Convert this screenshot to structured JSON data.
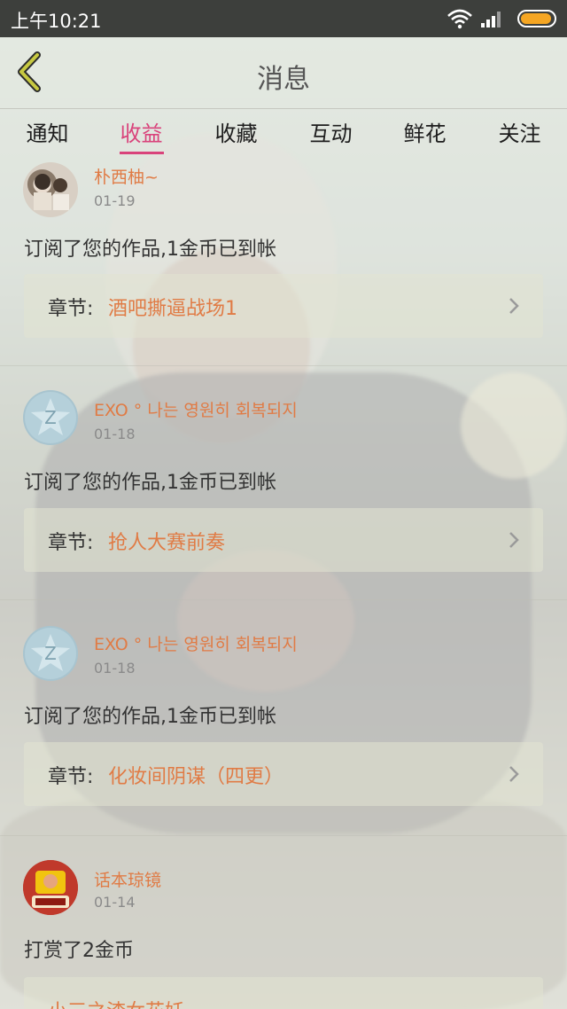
{
  "status_bar": {
    "time": "上午10:21"
  },
  "header": {
    "title": "消息"
  },
  "tabs": [
    {
      "label": "通知"
    },
    {
      "label": "收益"
    },
    {
      "label": "收藏"
    },
    {
      "label": "互动"
    },
    {
      "label": "鲜花"
    },
    {
      "label": "关注"
    }
  ],
  "messages": [
    {
      "username": "朴西柚~",
      "date": "01-19",
      "text": "订阅了您的作品,1金币已到帐",
      "chapter_prefix": "章节:",
      "chapter_title": "酒吧撕逼战场1"
    },
    {
      "username": "EXO ° 나는 영원히 회복되지",
      "date": "01-18",
      "text": "订阅了您的作品,1金币已到帐",
      "chapter_prefix": "章节:",
      "chapter_title": "抢人大赛前奏"
    },
    {
      "username": "EXO ° 나는 영원히 회복되지",
      "date": "01-18",
      "text": "订阅了您的作品,1金币已到帐",
      "chapter_prefix": "章节:",
      "chapter_title": "化妆间阴谋（四更）"
    },
    {
      "username": "话本琼镜",
      "date": "01-14",
      "text": "打赏了2金币",
      "chapter_title": "小三之渣女花妖"
    }
  ],
  "colors": {
    "accent": "#d9437b",
    "username": "#e07b45",
    "battery": "#f5a623"
  }
}
